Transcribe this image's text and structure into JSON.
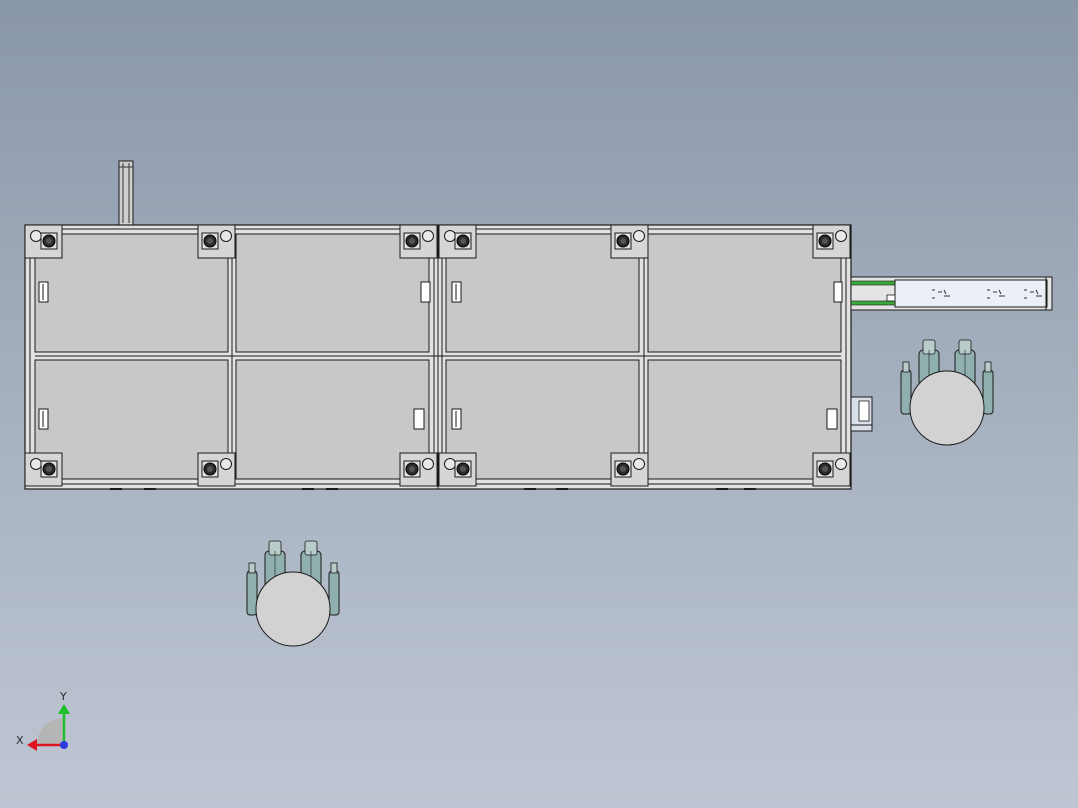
{
  "view": {
    "type": "cad-top-view",
    "background_top": "#8a97a9",
    "background_bottom": "#bfc6d3"
  },
  "triad": {
    "x_label": "X",
    "y_label": "Y",
    "x_color": "#e0141e",
    "y_color": "#1fbf2a",
    "z_color": "#2a3be0"
  },
  "colors": {
    "panel": "#c8c8c8",
    "frame": "#e2e2e2",
    "line": "#1a1a1a",
    "rail_green": "#3aa83a",
    "gripper": "#8fb0ae",
    "disc": "#d2d2d2"
  }
}
